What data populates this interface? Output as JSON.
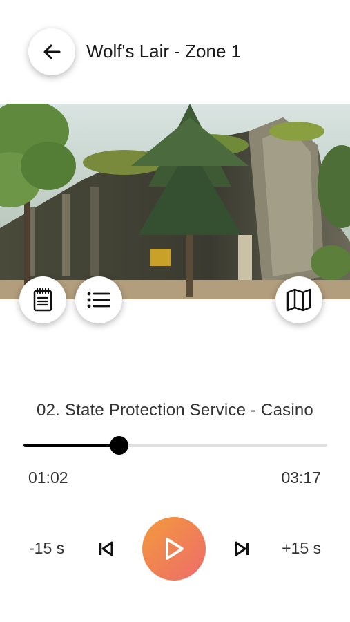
{
  "header": {
    "title": "Wolf's Lair - Zone 1",
    "back_icon": "arrow-left-icon"
  },
  "actions": {
    "notes_icon": "clipboard-notes-icon",
    "list_icon": "list-icon",
    "map_icon": "map-icon"
  },
  "player": {
    "track_title": "02. State Protection Service - Casino",
    "current_time": "01:02",
    "total_time": "03:17",
    "progress": 0.313,
    "rewind_label": "-15 s",
    "forward_label": "+15 s",
    "accent_start": "#f29a3c",
    "accent_end": "#ee6b6b"
  }
}
